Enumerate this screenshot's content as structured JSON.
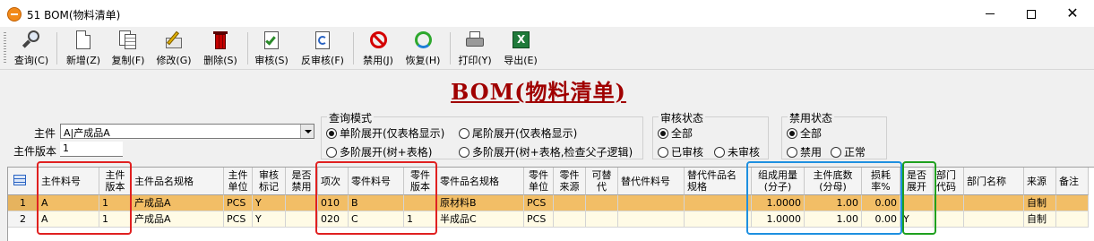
{
  "window": {
    "title": "51 BOM(物料清单)"
  },
  "toolbar": {
    "query": "查询(C)",
    "new": "新增(Z)",
    "copy": "复制(F)",
    "edit": "修改(G)",
    "delete": "删除(S)",
    "approve": "审核(S)",
    "unapprove": "反审核(F)",
    "disable": "禁用(J)",
    "restore": "恢复(H)",
    "print": "打印(Y)",
    "export": "导出(E)"
  },
  "page": {
    "heading": "BOM(物料清单)"
  },
  "form": {
    "parent_label": "主件",
    "parent_value": "A|产成品A",
    "version_label": "主件版本",
    "version_value": "1"
  },
  "query_mode": {
    "title": "查询模式",
    "options": [
      {
        "label": "单阶展开(仅表格显示)",
        "selected": true
      },
      {
        "label": "尾阶展开(仅表格显示)",
        "selected": false
      },
      {
        "label": "多阶展开(树+表格)",
        "selected": false
      },
      {
        "label": "多阶展开(树+表格,检查父子逻辑)",
        "selected": false
      }
    ]
  },
  "review_status": {
    "title": "审核状态",
    "options": [
      {
        "label": "全部",
        "selected": true
      },
      {
        "label": "已审核",
        "selected": false
      },
      {
        "label": "未审核",
        "selected": false
      }
    ]
  },
  "disable_status": {
    "title": "禁用状态",
    "options": [
      {
        "label": "全部",
        "selected": true
      },
      {
        "label": "禁用",
        "selected": false
      },
      {
        "label": "正常",
        "selected": false
      }
    ]
  },
  "grid": {
    "columns": [
      "主件料号",
      "主件\n版本",
      "主件品名规格",
      "主件\n单位",
      "审核\n标记",
      "是否\n禁用",
      "项次",
      "零件料号",
      "零件\n版本",
      "零件品名规格",
      "零件\n单位",
      "零件\n来源",
      "可替\n代",
      "替代件料号",
      "替代件品名\n规格",
      "组成用量\n(分子)",
      "主件底数\n(分母)",
      "损耗\n率%",
      "是否\n展开",
      "部门\n代码",
      "部门名称",
      "来源",
      "备注"
    ],
    "rows": [
      {
        "num": "1",
        "cells": [
          "A",
          "1",
          "产成品A",
          "PCS",
          "Y",
          "",
          "010",
          "B",
          "",
          "原材料B",
          "PCS",
          "",
          "",
          "",
          "",
          "1.0000",
          "1.00",
          "0.00",
          "",
          "",
          "",
          "自制",
          ""
        ]
      },
      {
        "num": "2",
        "cells": [
          "A",
          "1",
          "产成品A",
          "PCS",
          "Y",
          "",
          "020",
          "C",
          "1",
          "半成品C",
          "PCS",
          "",
          "",
          "",
          "",
          "1.0000",
          "1.00",
          "0.00",
          "Y",
          "",
          "",
          "自制",
          ""
        ]
      }
    ]
  },
  "colors": {
    "heading": "#a00000",
    "selected_row": "#f2be66",
    "other_row": "#fffbe6",
    "highlight_red": "#e02020",
    "highlight_blue": "#1e90e0",
    "highlight_green": "#1fa01f"
  }
}
